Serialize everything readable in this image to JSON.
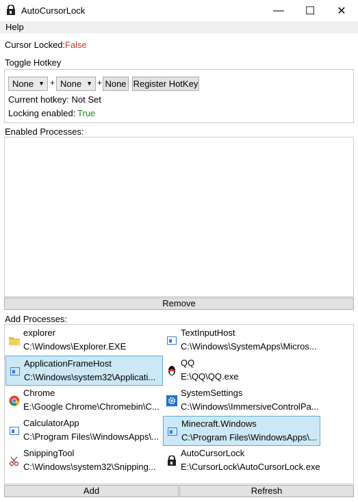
{
  "window": {
    "title": "AutoCursorLock",
    "minimize_glyph": "—",
    "maximize_glyph": "☐",
    "close_glyph": "✕"
  },
  "menu": {
    "help": "Help"
  },
  "status": {
    "cursor_locked_label": "Cursor Locked:",
    "cursor_locked_value": "False"
  },
  "hotkey": {
    "group_label": "Toggle Hotkey",
    "modifier1": "None",
    "modifier2": "None",
    "key": "None",
    "plus": "+",
    "register_label": "Register HotKey",
    "current_label": "Current hotkey: Not Set",
    "locking_label": "Locking enabled:",
    "locking_value": "True"
  },
  "enabled": {
    "label": "Enabled Processes:",
    "remove_label": "Remove"
  },
  "add": {
    "label": "Add Processes:",
    "add_label": "Add",
    "refresh_label": "Refresh",
    "processes": [
      {
        "name": "explorer",
        "path": "C:\\Windows\\Explorer.EXE",
        "icon": "folder-icon",
        "selected": false
      },
      {
        "name": "TextInputHost",
        "path": "C:\\Windows\\SystemApps\\Micros...",
        "icon": "window-icon",
        "selected": false
      },
      {
        "name": "ApplicationFrameHost",
        "path": "C:\\Windows\\system32\\Applicati...",
        "icon": "window-icon",
        "selected": true
      },
      {
        "name": "QQ",
        "path": "E:\\QQ\\QQ.exe",
        "icon": "penguin-icon",
        "selected": false
      },
      {
        "name": "Chrome",
        "path": "E:\\Google Chrome\\Chromebin\\C...",
        "icon": "chrome-icon",
        "selected": false
      },
      {
        "name": "SystemSettings",
        "path": "C:\\Windows\\ImmersiveControlPa...",
        "icon": "gear-icon",
        "selected": false
      },
      {
        "name": "CalculatorApp",
        "path": "C:\\Program Files\\WindowsApps\\...",
        "icon": "window-icon",
        "selected": false
      },
      {
        "name": "Minecraft.Windows",
        "path": "C:\\Program Files\\WindowsApps\\...",
        "icon": "window-icon",
        "selected": true
      },
      {
        "name": "SnippingTool",
        "path": "C:\\Windows\\system32\\Snipping...",
        "icon": "snipping-icon",
        "selected": false
      },
      {
        "name": "AutoCursorLock",
        "path": "E:\\CursorLock\\AutoCursorLock.exe",
        "icon": "lock-icon",
        "selected": false
      }
    ]
  }
}
